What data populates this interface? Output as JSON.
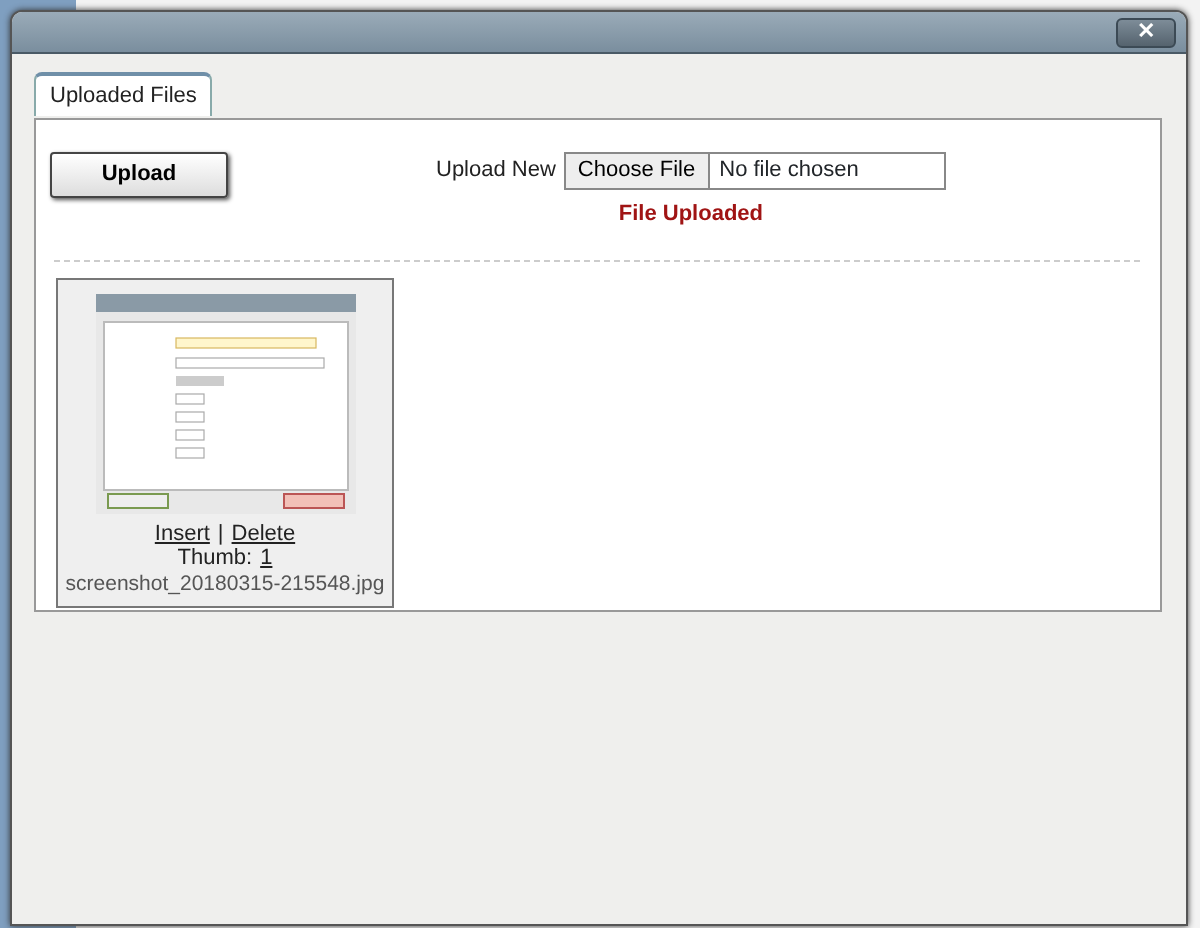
{
  "dialog": {
    "close_button": "✕"
  },
  "tabs": [
    {
      "label": "Uploaded Files",
      "selected": true
    }
  ],
  "upload_button": "Upload",
  "upload_new": {
    "label": "Upload New",
    "choose_button": "Choose File",
    "file_status": "No file chosen"
  },
  "message": "File Uploaded",
  "files": [
    {
      "kind": "picture",
      "insert_link": "Insert",
      "separator": "|",
      "delete_link": "Delete",
      "thumb_label": "Thumb:",
      "thumb_link": "1",
      "filename": "screenshot_20180315-215548.jpg"
    }
  ]
}
